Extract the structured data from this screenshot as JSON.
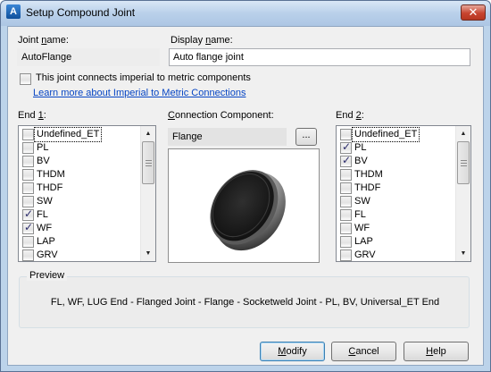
{
  "window": {
    "title": "Setup Compound Joint",
    "close_glyph": "✕",
    "app_icon_glyph": "A"
  },
  "joint_name": {
    "label_pre": "Joint ",
    "label_u": "n",
    "label_post": "ame:",
    "value": "AutoFlange"
  },
  "display_name": {
    "label_pre": "Display name",
    "label_u": "",
    "label_post": ":",
    "value": "Auto flange joint"
  },
  "imperial_checkbox": {
    "label": "This joint connects imperial to metric components",
    "checked": false
  },
  "learn_more_link": "Learn more about Imperial to Metric Connections",
  "end1": {
    "label_pre": "End ",
    "label_u": "1",
    "label_post": ":",
    "items": [
      {
        "label": "Undefined_ET",
        "checked": false
      },
      {
        "label": "PL",
        "checked": false
      },
      {
        "label": "BV",
        "checked": false
      },
      {
        "label": "THDM",
        "checked": false
      },
      {
        "label": "THDF",
        "checked": false
      },
      {
        "label": "SW",
        "checked": false
      },
      {
        "label": "FL",
        "checked": true
      },
      {
        "label": "WF",
        "checked": true
      },
      {
        "label": "LAP",
        "checked": false
      },
      {
        "label": "GRV",
        "checked": false
      }
    ]
  },
  "connection_component": {
    "label_pre": "",
    "label_u": "C",
    "label_post": "onnection Component:",
    "value": "Flange",
    "browse_label": "..."
  },
  "end2": {
    "label_pre": "End ",
    "label_u": "2",
    "label_post": ":",
    "items": [
      {
        "label": "Undefined_ET",
        "checked": false
      },
      {
        "label": "PL",
        "checked": true
      },
      {
        "label": "BV",
        "checked": true
      },
      {
        "label": "THDM",
        "checked": false
      },
      {
        "label": "THDF",
        "checked": false
      },
      {
        "label": "SW",
        "checked": false
      },
      {
        "label": "FL",
        "checked": false
      },
      {
        "label": "WF",
        "checked": false
      },
      {
        "label": "LAP",
        "checked": false
      },
      {
        "label": "GRV",
        "checked": false
      }
    ]
  },
  "preview": {
    "legend": "Preview",
    "text": "FL, WF, LUG End - Flanged Joint - Flange - Socketweld Joint - PL, BV, Universal_ET End"
  },
  "buttons": {
    "modify": {
      "u": "M",
      "rest": "odify"
    },
    "cancel": {
      "u": "C",
      "rest": "ancel"
    },
    "help": {
      "u": "H",
      "rest": "elp"
    }
  },
  "scroll_arrows": {
    "up": "▲",
    "down": "▼"
  }
}
